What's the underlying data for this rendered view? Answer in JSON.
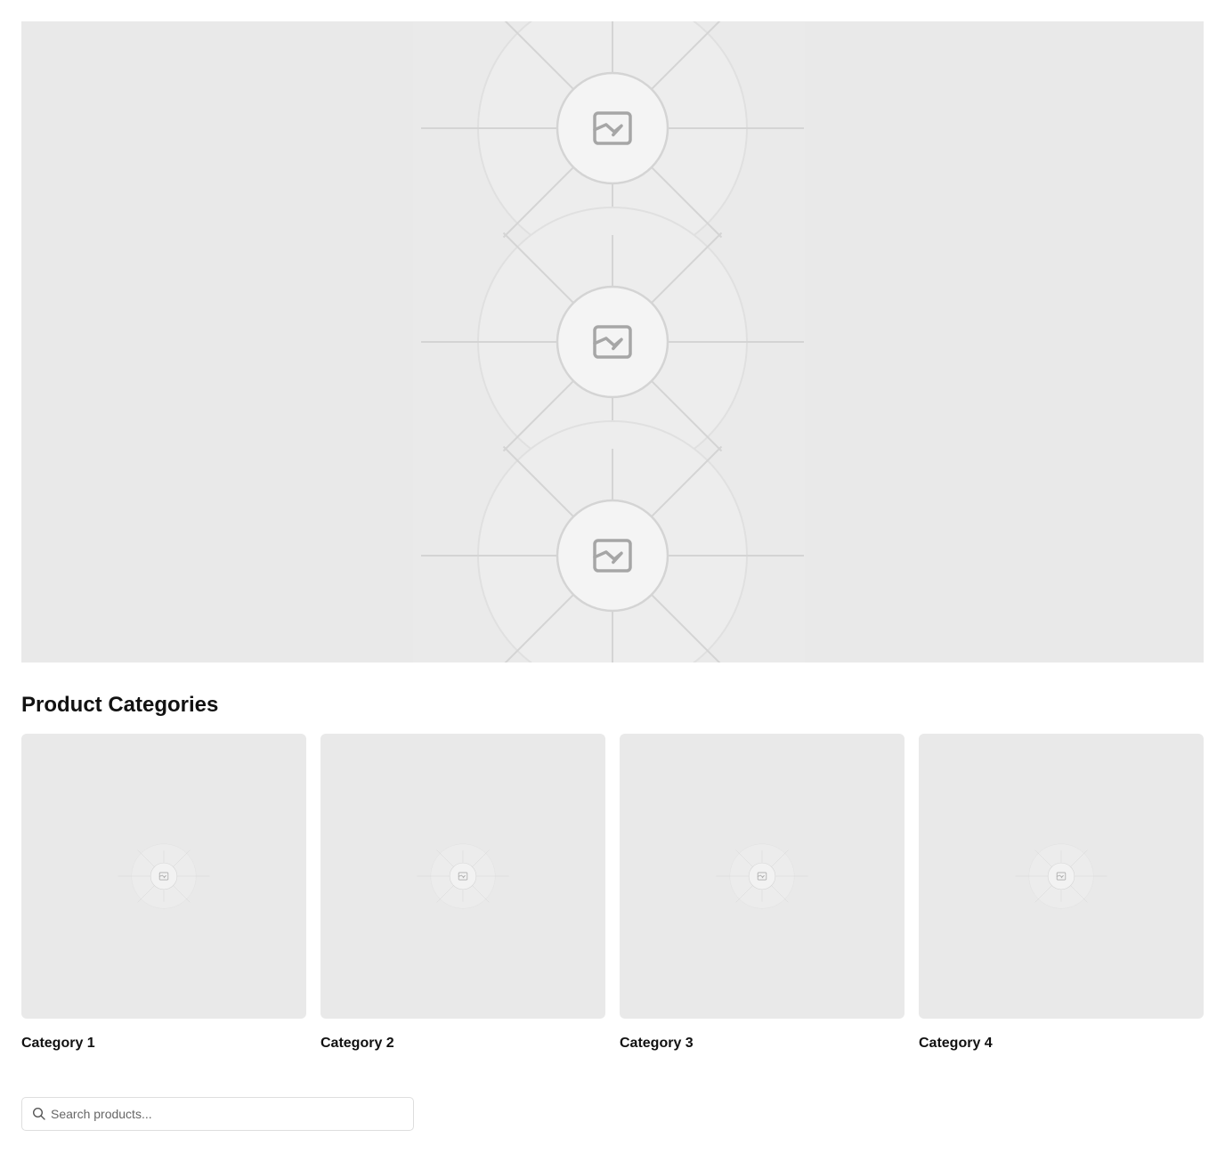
{
  "hero": {
    "placeholder_icon": "image-placeholder-icon"
  },
  "categories_section": {
    "title": "Product Categories",
    "items": [
      {
        "label": "Category 1",
        "icon": "image-placeholder-icon"
      },
      {
        "label": "Category 2",
        "icon": "image-placeholder-icon"
      },
      {
        "label": "Category 3",
        "icon": "image-placeholder-icon"
      },
      {
        "label": "Category 4",
        "icon": "image-placeholder-icon"
      }
    ]
  },
  "search": {
    "placeholder": "Search products...",
    "value": "",
    "icon": "search-icon"
  },
  "colors": {
    "placeholder_bg": "#e9e9e9",
    "line": "#d4d4d4",
    "icon": "#a6a6a6",
    "text": "#111111"
  }
}
